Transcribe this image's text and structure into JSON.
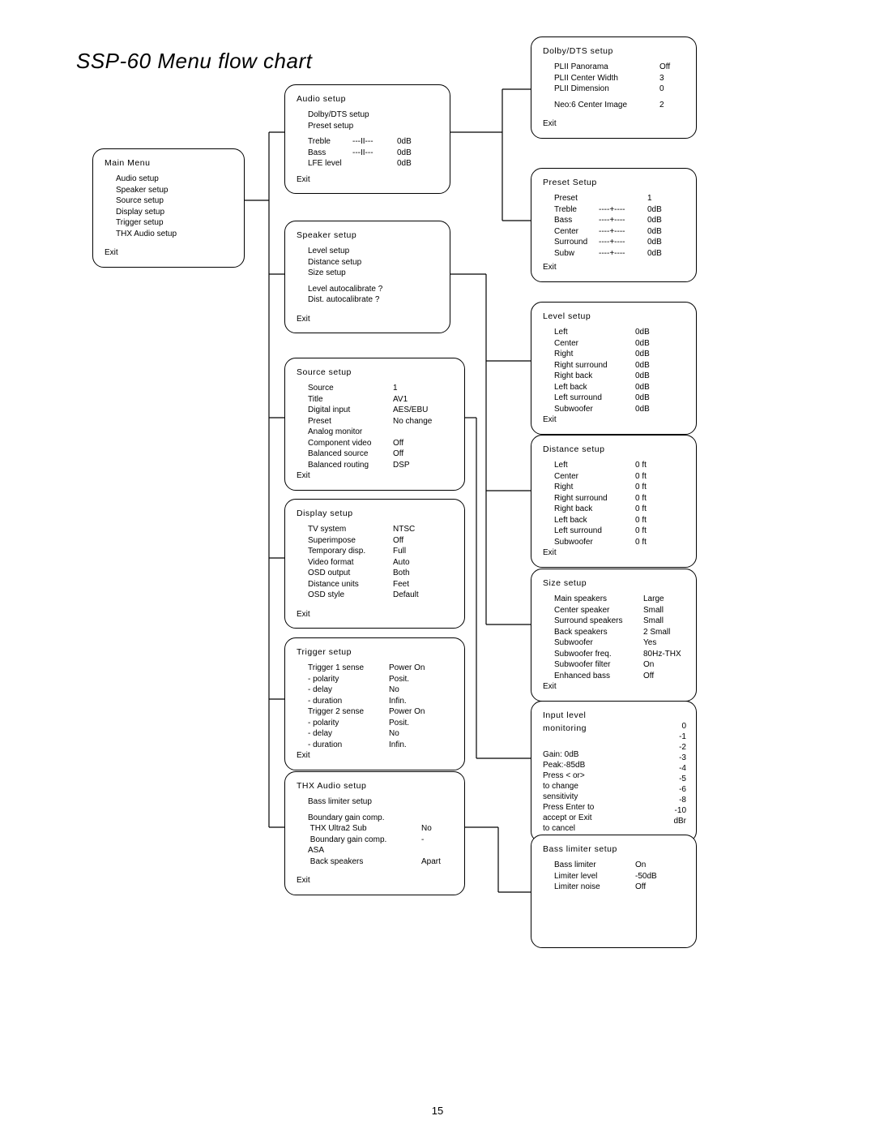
{
  "page_number": "15",
  "title": "SSP-60 Menu flow chart",
  "exit_label": "Exit",
  "main_menu": {
    "title": "Main Menu",
    "items": [
      "Audio setup",
      "Speaker setup",
      "Source setup",
      "Display setup",
      "Trigger setup",
      "THX Audio setup"
    ]
  },
  "audio_setup": {
    "title": "Audio setup",
    "lines": [
      {
        "label": "Dolby/DTS setup",
        "value": ""
      },
      {
        "label": "Preset setup",
        "value": ""
      }
    ],
    "values": [
      {
        "label": "Treble",
        "mid": "---II---",
        "value": "0dB"
      },
      {
        "label": "Bass",
        "mid": "---II---",
        "value": "0dB"
      },
      {
        "label": "LFE level",
        "mid": "",
        "value": "0dB"
      }
    ]
  },
  "speaker_setup": {
    "title": "Speaker setup",
    "items": [
      "Level setup",
      "Distance setup",
      "Size setup"
    ],
    "items2": [
      "Level autocalibrate ?",
      "Dist. autocalibrate ?"
    ]
  },
  "source_setup": {
    "title": "Source setup",
    "rows": [
      {
        "label": "Source",
        "value": "1"
      },
      {
        "label": "Title",
        "value": "AV1"
      },
      {
        "label": "Digital input",
        "value": "AES/EBU"
      },
      {
        "label": "Preset",
        "value": "No change"
      },
      {
        "label": "Analog monitor",
        "value": ""
      },
      {
        "label": "Component video",
        "value": "Off"
      },
      {
        "label": "Balanced source",
        "value": "Off"
      },
      {
        "label": "Balanced routing",
        "value": "DSP"
      }
    ]
  },
  "display_setup": {
    "title": "Display setup",
    "rows": [
      {
        "label": "TV system",
        "value": "NTSC"
      },
      {
        "label": "Superimpose",
        "value": "Off"
      },
      {
        "label": "Temporary disp.",
        "value": "Full"
      },
      {
        "label": "Video format",
        "value": "Auto"
      },
      {
        "label": "OSD output",
        "value": "Both"
      },
      {
        "label": "Distance units",
        "value": "Feet"
      },
      {
        "label": "OSD style",
        "value": "Default"
      }
    ]
  },
  "trigger_setup": {
    "title": "Trigger setup",
    "rows": [
      {
        "label": "Trigger 1 sense",
        "value": "Power On"
      },
      {
        "label": "- polarity",
        "value": "Posit."
      },
      {
        "label": "- delay",
        "value": "No"
      },
      {
        "label": "- duration",
        "value": "Infin."
      },
      {
        "label": "Trigger 2 sense",
        "value": "Power On"
      },
      {
        "label": "- polarity",
        "value": "Posit."
      },
      {
        "label": "- delay",
        "value": "No"
      },
      {
        "label": "- duration",
        "value": "Infin."
      }
    ]
  },
  "thx_audio_setup": {
    "title": "THX Audio setup",
    "line1": "Bass limiter setup",
    "line2": "Boundary gain comp.",
    "rows": [
      {
        "label": " THX Ultra2 Sub",
        "value": "No"
      },
      {
        "label": " Boundary gain comp.",
        "value": "-"
      }
    ],
    "asa": "ASA",
    "rows2": [
      {
        "label": " Back speakers",
        "value": "Apart"
      }
    ]
  },
  "dolby_dts_setup": {
    "title": "Dolby/DTS setup",
    "rows": [
      {
        "label": "PLII Panorama",
        "value": "Off"
      },
      {
        "label": "PLII Center Width",
        "value": "3"
      },
      {
        "label": "PLII Dimension",
        "value": "0"
      }
    ],
    "rows2": [
      {
        "label": "Neo:6 Center Image",
        "value": "2"
      }
    ]
  },
  "preset_setup": {
    "title": "Preset Setup",
    "rows": [
      {
        "label": "Preset",
        "mid": "",
        "value": "1"
      },
      {
        "label": "Treble",
        "mid": "----+----",
        "value": "0dB"
      },
      {
        "label": "Bass",
        "mid": "----+----",
        "value": "0dB"
      },
      {
        "label": "Center",
        "mid": "----+----",
        "value": "0dB"
      },
      {
        "label": "Surround",
        "mid": "----+----",
        "value": "0dB"
      },
      {
        "label": "Subw",
        "mid": "----+----",
        "value": "0dB"
      }
    ]
  },
  "level_setup": {
    "title": "Level setup",
    "rows": [
      {
        "label": "Left",
        "value": "0dB"
      },
      {
        "label": "Center",
        "value": "0dB"
      },
      {
        "label": "Right",
        "value": "0dB"
      },
      {
        "label": "Right surround",
        "value": "0dB"
      },
      {
        "label": "Right back",
        "value": "0dB"
      },
      {
        "label": "Left back",
        "value": "0dB"
      },
      {
        "label": "Left surround",
        "value": "0dB"
      },
      {
        "label": "Subwoofer",
        "value": "0dB"
      }
    ]
  },
  "distance_setup": {
    "title": "Distance setup",
    "rows": [
      {
        "label": "Left",
        "value": "0 ft"
      },
      {
        "label": "Center",
        "value": "0 ft"
      },
      {
        "label": "Right",
        "value": "0 ft"
      },
      {
        "label": "Right surround",
        "value": "0 ft"
      },
      {
        "label": "Right back",
        "value": "0 ft"
      },
      {
        "label": "Left back",
        "value": "0 ft"
      },
      {
        "label": "Left surround",
        "value": "0 ft"
      },
      {
        "label": "Subwoofer",
        "value": "0 ft"
      }
    ]
  },
  "size_setup": {
    "title": "Size setup",
    "rows": [
      {
        "label": "Main speakers",
        "value": "Large"
      },
      {
        "label": "Center speaker",
        "value": "Small"
      },
      {
        "label": "Surround speakers",
        "value": "Small"
      },
      {
        "label": "Back speakers",
        "value": "2 Small"
      },
      {
        "label": "Subwoofer",
        "value": "Yes"
      },
      {
        "label": "Subwoofer freq.",
        "value": "80Hz-THX"
      },
      {
        "label": "Subwoofer filter",
        "value": "On"
      },
      {
        "label": "Enhanced bass",
        "value": "Off"
      }
    ]
  },
  "input_level": {
    "title1": "Input level",
    "title2": "monitoring",
    "left_lines": [
      "",
      "Gain:  0dB",
      "Peak:-85dB",
      "Press < or>",
      "to change",
      "sensitivity",
      "Press Enter to",
      "accept or Exit",
      "to cancel"
    ],
    "right_vals": [
      "0",
      "-1",
      "-2",
      "-3",
      "-4",
      "-5",
      "-6",
      "-8",
      "-10",
      "dBr"
    ]
  },
  "bass_limiter_setup": {
    "title": "Bass limiter setup",
    "rows": [
      {
        "label": "Bass limiter",
        "value": "On"
      },
      {
        "label": "Limiter level",
        "value": "-50dB"
      },
      {
        "label": "Limiter noise",
        "value": "Off"
      }
    ]
  }
}
